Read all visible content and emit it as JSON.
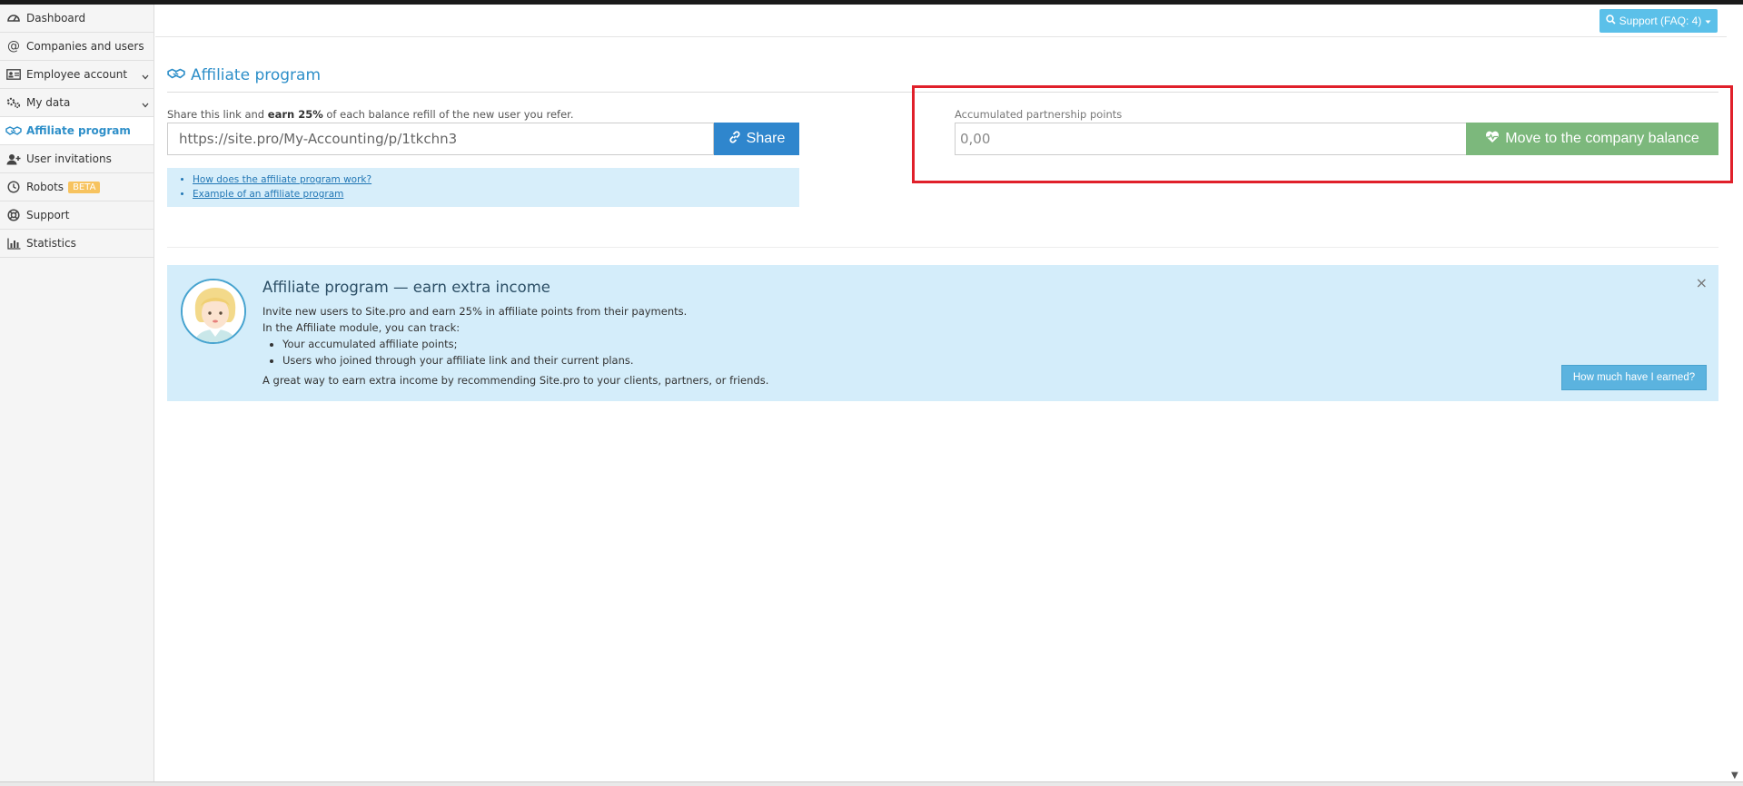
{
  "sidebar": {
    "items": [
      {
        "label": "Dashboard",
        "icon": "dashboard-icon"
      },
      {
        "label": "Companies and users",
        "icon": "at-icon"
      },
      {
        "label": "Employee account",
        "icon": "id-card-icon",
        "expandable": true
      },
      {
        "label": "My data",
        "icon": "gears-icon",
        "expandable": true
      },
      {
        "label": "Affiliate program",
        "icon": "handshake-icon",
        "active": true
      },
      {
        "label": "User invitations",
        "icon": "user-plus-icon"
      },
      {
        "label": "Robots",
        "icon": "clock-icon",
        "badge": "BETA"
      },
      {
        "label": "Support",
        "icon": "lifebuoy-icon"
      },
      {
        "label": "Statistics",
        "icon": "bar-chart-icon"
      }
    ]
  },
  "header": {
    "support_label": "Support (FAQ: 4)"
  },
  "page": {
    "title": "Affiliate program"
  },
  "share": {
    "hint_prefix": "Share this link and ",
    "hint_bold": "earn 25%",
    "hint_suffix": " of each balance refill of the new user you refer.",
    "link_value": "https://site.pro/My-Accounting/p/1tkchn3",
    "button_label": "Share",
    "links": [
      "How does the affiliate program work?",
      "Example of an affiliate program"
    ]
  },
  "points": {
    "label": "Accumulated partnership points",
    "value": "0,00",
    "button_label": "Move to the company balance"
  },
  "banner": {
    "title": "Affiliate program — earn extra income",
    "line1": "Invite new users to Site.pro and earn 25% in affiliate points from their payments.",
    "line2": "In the Affiliate module, you can track:",
    "bullets": [
      "Your accumulated affiliate points;",
      "Users who joined through your affiliate link and their current plans."
    ],
    "footer": "A great way to earn extra income by recommending Site.pro to your clients, partners, or friends.",
    "close": "×",
    "earned_button": "How much have I earned?"
  },
  "colors": {
    "accent": "#2e8fc9",
    "share_button": "#2f86cd",
    "move_button": "#7cb87c",
    "highlight_border": "#e0202a",
    "banner_bg": "#d4edfa"
  }
}
